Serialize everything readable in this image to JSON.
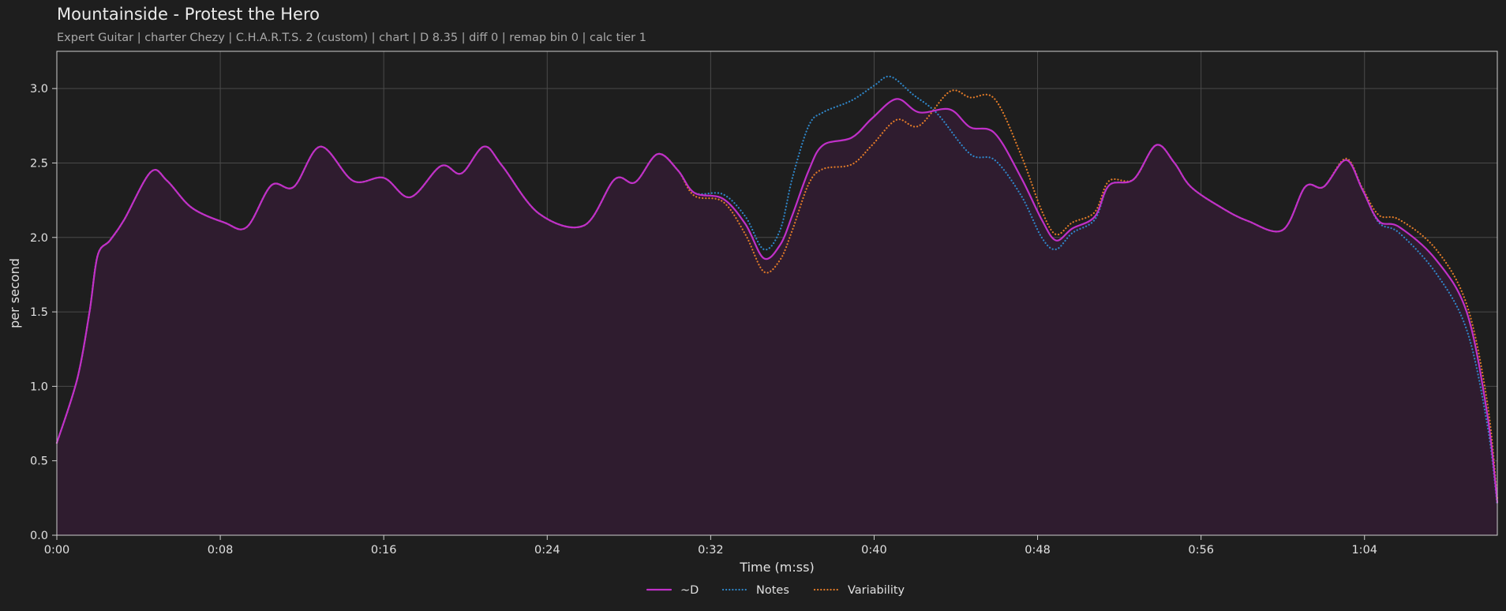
{
  "chart_data": {
    "type": "line",
    "title": "Mountainside - Protest the Hero",
    "subtitle": "Expert Guitar  |  charter Chezy  |  C.H.A.R.T.S. 2 (custom)  |  chart  |  D 8.35  |  diff 0  |  remap bin 0  |  calc tier 1",
    "xlabel": "Time (m:ss)",
    "ylabel": "per second",
    "xlim": [
      0,
      70.5
    ],
    "ylim": [
      0,
      3.25
    ],
    "grid": true,
    "legend_position": "bottom-center",
    "x_ticks": [
      {
        "value": 0,
        "label": "0:00"
      },
      {
        "value": 8,
        "label": "0:08"
      },
      {
        "value": 16,
        "label": "0:16"
      },
      {
        "value": 24,
        "label": "0:24"
      },
      {
        "value": 32,
        "label": "0:32"
      },
      {
        "value": 40,
        "label": "0:40"
      },
      {
        "value": 48,
        "label": "0:48"
      },
      {
        "value": 56,
        "label": "0:56"
      },
      {
        "value": 64,
        "label": "1:04"
      }
    ],
    "y_ticks": [
      {
        "value": 0.0,
        "label": "0.0"
      },
      {
        "value": 0.5,
        "label": "0.5"
      },
      {
        "value": 1.0,
        "label": "1.0"
      },
      {
        "value": 1.5,
        "label": "1.5"
      },
      {
        "value": 2.0,
        "label": "2.0"
      },
      {
        "value": 2.5,
        "label": "2.5"
      },
      {
        "value": 3.0,
        "label": "3.0"
      }
    ],
    "series": [
      {
        "name": "~D",
        "color": "#c030c8",
        "style": "solid",
        "fill": true,
        "points": [
          [
            0,
            0.62
          ],
          [
            1,
            1.05
          ],
          [
            1.6,
            1.5
          ],
          [
            2,
            1.88
          ],
          [
            2.6,
            1.98
          ],
          [
            3.3,
            2.12
          ],
          [
            4.6,
            2.44
          ],
          [
            5.4,
            2.38
          ],
          [
            6.6,
            2.2
          ],
          [
            8.2,
            2.1
          ],
          [
            9.3,
            2.07
          ],
          [
            10.5,
            2.35
          ],
          [
            11.6,
            2.34
          ],
          [
            12.9,
            2.61
          ],
          [
            14.5,
            2.38
          ],
          [
            16,
            2.4
          ],
          [
            17.3,
            2.27
          ],
          [
            18.8,
            2.48
          ],
          [
            19.8,
            2.43
          ],
          [
            20.9,
            2.61
          ],
          [
            21.8,
            2.48
          ],
          [
            23.6,
            2.16
          ],
          [
            25.8,
            2.08
          ],
          [
            27.3,
            2.39
          ],
          [
            28.3,
            2.37
          ],
          [
            29.4,
            2.56
          ],
          [
            30.4,
            2.45
          ],
          [
            31.2,
            2.3
          ],
          [
            32.6,
            2.26
          ],
          [
            33.7,
            2.09
          ],
          [
            34.6,
            1.86
          ],
          [
            35.4,
            1.95
          ],
          [
            36,
            2.15
          ],
          [
            36.8,
            2.45
          ],
          [
            37.5,
            2.62
          ],
          [
            38.9,
            2.67
          ],
          [
            39.9,
            2.8
          ],
          [
            41.1,
            2.93
          ],
          [
            42.2,
            2.84
          ],
          [
            43.7,
            2.86
          ],
          [
            44.7,
            2.74
          ],
          [
            45.9,
            2.7
          ],
          [
            47.2,
            2.4
          ],
          [
            48.2,
            2.12
          ],
          [
            48.9,
            1.98
          ],
          [
            49.7,
            2.06
          ],
          [
            50.8,
            2.14
          ],
          [
            51.5,
            2.35
          ],
          [
            52.7,
            2.39
          ],
          [
            53.8,
            2.62
          ],
          [
            54.7,
            2.5
          ],
          [
            55.5,
            2.34
          ],
          [
            57,
            2.2
          ],
          [
            58.3,
            2.11
          ],
          [
            60,
            2.05
          ],
          [
            61.1,
            2.34
          ],
          [
            62,
            2.34
          ],
          [
            63.1,
            2.52
          ],
          [
            63.9,
            2.32
          ],
          [
            64.7,
            2.11
          ],
          [
            65.7,
            2.07
          ],
          [
            67.5,
            1.85
          ],
          [
            69,
            1.5
          ],
          [
            70,
            0.82
          ],
          [
            70.5,
            0.22
          ]
        ]
      },
      {
        "name": "Notes",
        "color": "#2f86c8",
        "style": "dotted",
        "fill": false,
        "points": [
          [
            0,
            0.62
          ],
          [
            1,
            1.05
          ],
          [
            1.6,
            1.5
          ],
          [
            2,
            1.88
          ],
          [
            2.6,
            1.98
          ],
          [
            3.3,
            2.12
          ],
          [
            4.6,
            2.44
          ],
          [
            5.4,
            2.38
          ],
          [
            6.6,
            2.2
          ],
          [
            8.2,
            2.1
          ],
          [
            9.3,
            2.07
          ],
          [
            10.5,
            2.35
          ],
          [
            11.6,
            2.34
          ],
          [
            12.9,
            2.61
          ],
          [
            14.5,
            2.38
          ],
          [
            16,
            2.4
          ],
          [
            17.3,
            2.27
          ],
          [
            18.8,
            2.48
          ],
          [
            19.8,
            2.43
          ],
          [
            20.9,
            2.61
          ],
          [
            21.8,
            2.48
          ],
          [
            23.6,
            2.16
          ],
          [
            25.8,
            2.08
          ],
          [
            27.3,
            2.39
          ],
          [
            28.3,
            2.37
          ],
          [
            29.4,
            2.56
          ],
          [
            30.4,
            2.45
          ],
          [
            31.2,
            2.3
          ],
          [
            32.6,
            2.29
          ],
          [
            33.7,
            2.14
          ],
          [
            34.6,
            1.92
          ],
          [
            35.4,
            2.05
          ],
          [
            36,
            2.4
          ],
          [
            36.8,
            2.75
          ],
          [
            37.5,
            2.84
          ],
          [
            38.9,
            2.92
          ],
          [
            40,
            3.02
          ],
          [
            40.8,
            3.08
          ],
          [
            41.9,
            2.96
          ],
          [
            43.1,
            2.83
          ],
          [
            44.7,
            2.56
          ],
          [
            45.9,
            2.52
          ],
          [
            47.2,
            2.28
          ],
          [
            48.2,
            2.0
          ],
          [
            48.9,
            1.92
          ],
          [
            49.7,
            2.03
          ],
          [
            50.8,
            2.12
          ],
          [
            51.5,
            2.35
          ],
          [
            52.7,
            2.39
          ],
          [
            53.8,
            2.62
          ],
          [
            54.7,
            2.5
          ],
          [
            55.5,
            2.34
          ],
          [
            57,
            2.2
          ],
          [
            58.3,
            2.11
          ],
          [
            60,
            2.05
          ],
          [
            61.1,
            2.34
          ],
          [
            62,
            2.34
          ],
          [
            63.1,
            2.52
          ],
          [
            63.9,
            2.32
          ],
          [
            64.7,
            2.1
          ],
          [
            65.7,
            2.03
          ],
          [
            67.5,
            1.76
          ],
          [
            69,
            1.38
          ],
          [
            70,
            0.75
          ],
          [
            70.5,
            0.2
          ]
        ]
      },
      {
        "name": "Variability",
        "color": "#e07a28",
        "style": "dotted",
        "fill": false,
        "points": [
          [
            0,
            0.62
          ],
          [
            1,
            1.05
          ],
          [
            1.6,
            1.5
          ],
          [
            2,
            1.88
          ],
          [
            2.6,
            1.98
          ],
          [
            3.3,
            2.12
          ],
          [
            4.6,
            2.44
          ],
          [
            5.4,
            2.38
          ],
          [
            6.6,
            2.2
          ],
          [
            8.2,
            2.1
          ],
          [
            9.3,
            2.07
          ],
          [
            10.5,
            2.35
          ],
          [
            11.6,
            2.34
          ],
          [
            12.9,
            2.61
          ],
          [
            14.5,
            2.38
          ],
          [
            16,
            2.4
          ],
          [
            17.3,
            2.27
          ],
          [
            18.8,
            2.48
          ],
          [
            19.8,
            2.43
          ],
          [
            20.9,
            2.61
          ],
          [
            21.8,
            2.48
          ],
          [
            23.6,
            2.16
          ],
          [
            25.8,
            2.08
          ],
          [
            27.3,
            2.39
          ],
          [
            28.3,
            2.37
          ],
          [
            29.4,
            2.56
          ],
          [
            30.4,
            2.45
          ],
          [
            31.2,
            2.28
          ],
          [
            32.6,
            2.24
          ],
          [
            33.7,
            2.02
          ],
          [
            34.6,
            1.77
          ],
          [
            35.4,
            1.85
          ],
          [
            36,
            2.05
          ],
          [
            36.8,
            2.36
          ],
          [
            37.5,
            2.46
          ],
          [
            38.9,
            2.49
          ],
          [
            39.9,
            2.62
          ],
          [
            41.1,
            2.79
          ],
          [
            42.2,
            2.75
          ],
          [
            43.7,
            2.98
          ],
          [
            44.7,
            2.94
          ],
          [
            45.9,
            2.93
          ],
          [
            47.2,
            2.55
          ],
          [
            48.2,
            2.18
          ],
          [
            48.9,
            2.02
          ],
          [
            49.7,
            2.1
          ],
          [
            50.8,
            2.17
          ],
          [
            51.5,
            2.38
          ],
          [
            52.7,
            2.39
          ],
          [
            53.8,
            2.62
          ],
          [
            54.7,
            2.5
          ],
          [
            55.5,
            2.34
          ],
          [
            57,
            2.2
          ],
          [
            58.3,
            2.11
          ],
          [
            60,
            2.05
          ],
          [
            61.1,
            2.34
          ],
          [
            62,
            2.34
          ],
          [
            63.1,
            2.53
          ],
          [
            63.9,
            2.33
          ],
          [
            64.7,
            2.15
          ],
          [
            65.7,
            2.12
          ],
          [
            67.5,
            1.92
          ],
          [
            69,
            1.55
          ],
          [
            70,
            0.9
          ],
          [
            70.5,
            0.25
          ]
        ]
      }
    ]
  }
}
